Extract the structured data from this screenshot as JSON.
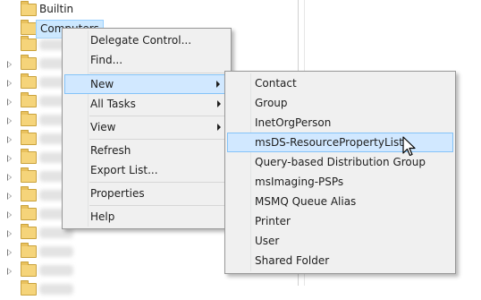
{
  "tree": {
    "items": [
      {
        "label": "Builtin",
        "expander": false,
        "selected": false,
        "blurred": false
      },
      {
        "label": "Computers",
        "expander": false,
        "selected": true,
        "blurred": false
      },
      {
        "label": "",
        "expander": false,
        "selected": false,
        "blurred": true
      },
      {
        "label": "",
        "expander": true,
        "selected": false,
        "blurred": true
      },
      {
        "label": "",
        "expander": true,
        "selected": false,
        "blurred": true
      },
      {
        "label": "",
        "expander": true,
        "selected": false,
        "blurred": true
      },
      {
        "label": "",
        "expander": true,
        "selected": false,
        "blurred": true
      },
      {
        "label": "",
        "expander": true,
        "selected": false,
        "blurred": true
      },
      {
        "label": "",
        "expander": true,
        "selected": false,
        "blurred": true
      },
      {
        "label": "",
        "expander": true,
        "selected": false,
        "blurred": true
      },
      {
        "label": "",
        "expander": true,
        "selected": false,
        "blurred": true
      },
      {
        "label": "",
        "expander": true,
        "selected": false,
        "blurred": true
      },
      {
        "label": "",
        "expander": true,
        "selected": false,
        "blurred": true
      },
      {
        "label": "",
        "expander": true,
        "selected": false,
        "blurred": true
      },
      {
        "label": "",
        "expander": true,
        "selected": false,
        "blurred": true
      }
    ]
  },
  "context_menu": {
    "items": [
      {
        "label": "Delegate Control..."
      },
      {
        "label": "Find..."
      },
      {
        "label": "New",
        "submenu": true,
        "highlighted": true
      },
      {
        "label": "All Tasks",
        "submenu": true
      },
      {
        "label": "View",
        "submenu": true
      },
      {
        "label": "Refresh"
      },
      {
        "label": "Export List..."
      },
      {
        "label": "Properties"
      },
      {
        "label": "Help"
      }
    ]
  },
  "new_submenu": {
    "items": [
      {
        "label": "Contact"
      },
      {
        "label": "Group"
      },
      {
        "label": "InetOrgPerson"
      },
      {
        "label": "msDS-ResourcePropertyList",
        "highlighted": true
      },
      {
        "label": "Query-based Distribution Group"
      },
      {
        "label": "msImaging-PSPs"
      },
      {
        "label": "MSMQ Queue Alias"
      },
      {
        "label": "Printer"
      },
      {
        "label": "User"
      },
      {
        "label": "Shared Folder"
      }
    ]
  },
  "colors": {
    "highlight_bg": "#d1e8ff",
    "highlight_border": "#84c3f8",
    "folder": "#f5d47a",
    "menu_bg": "#f0f0f0"
  },
  "icons": [
    "folder-icon",
    "expand-arrow-icon",
    "submenu-arrow-icon",
    "mouse-pointer-icon"
  ]
}
